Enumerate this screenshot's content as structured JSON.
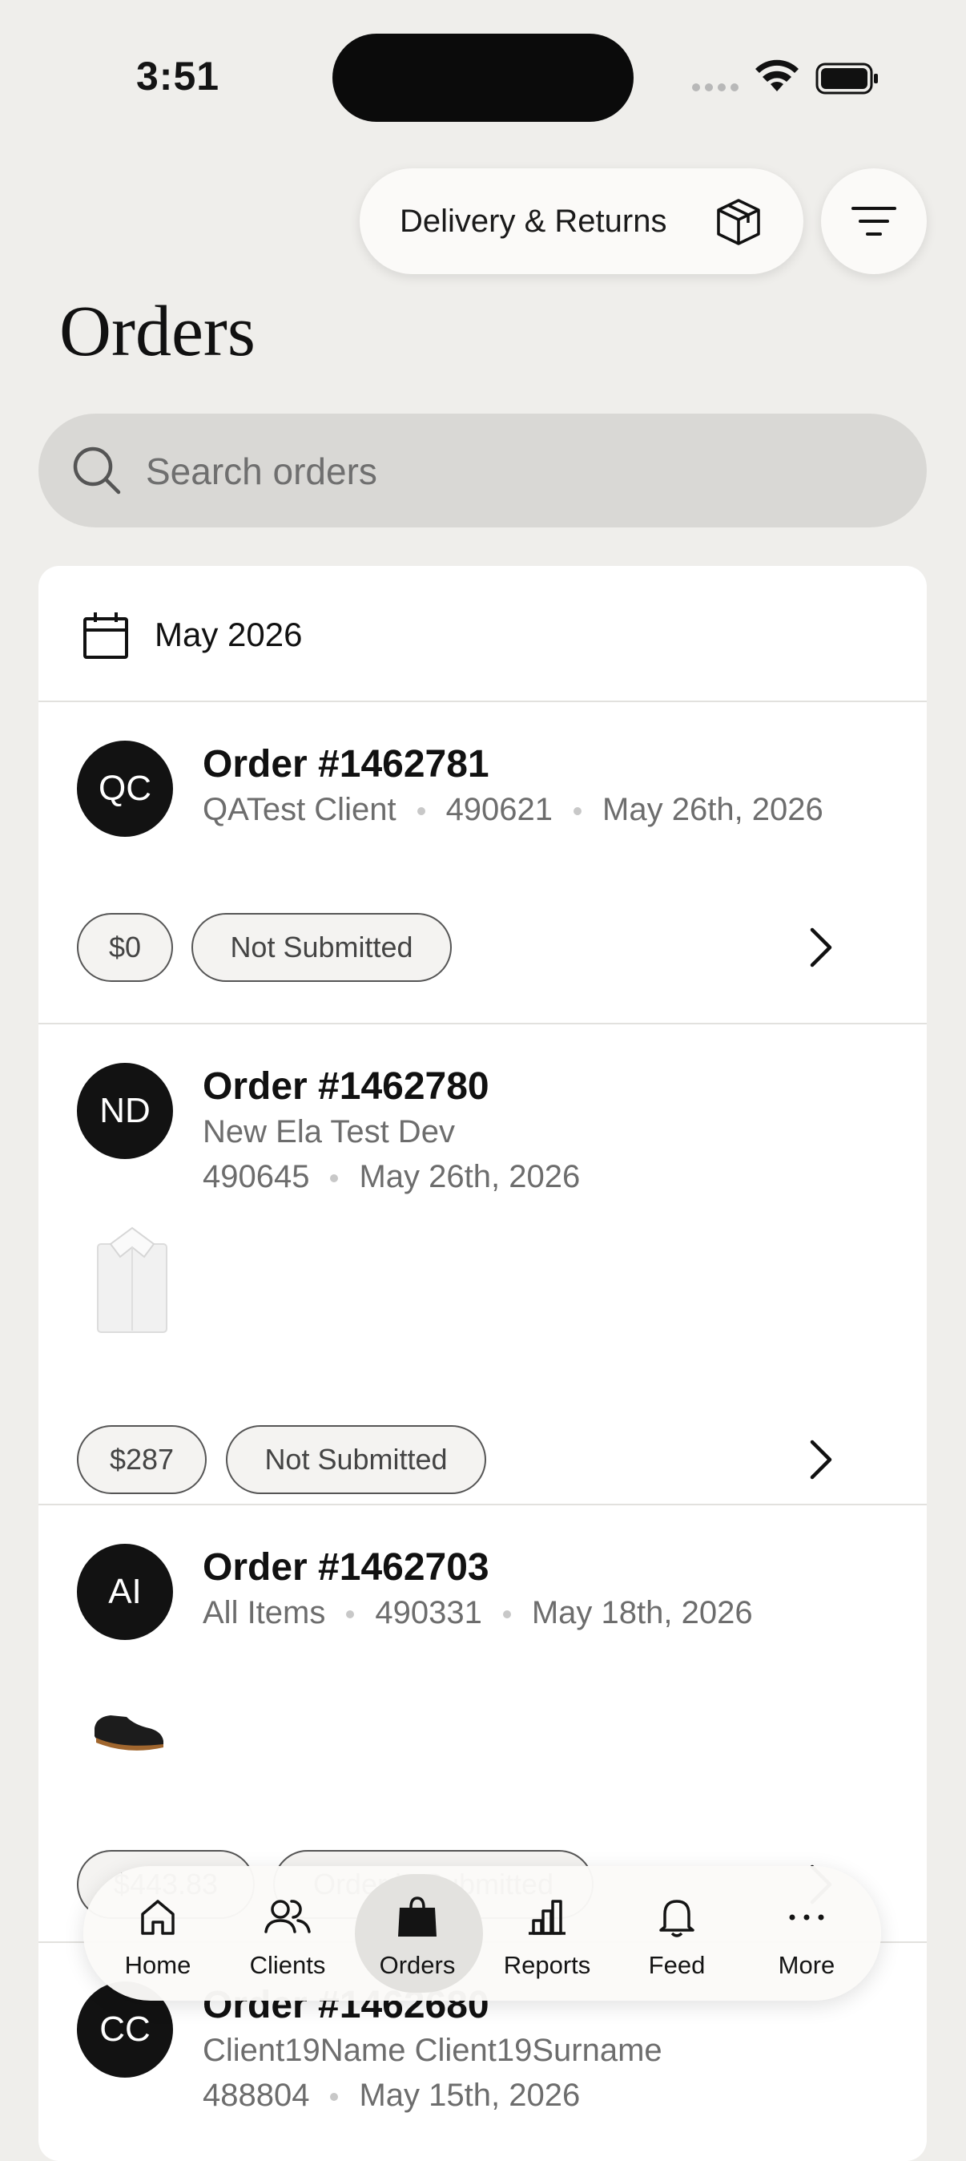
{
  "status_bar": {
    "time": "3:51"
  },
  "header": {
    "delivery_button_label": "Delivery & Returns",
    "title": "Orders"
  },
  "search": {
    "placeholder": "Search orders"
  },
  "month": "May 2026",
  "orders": [
    {
      "initials": "QC",
      "title": "Order #1462781",
      "client": "QATest Client",
      "account": "490621",
      "date": "May 26th, 2026",
      "amount": "$0",
      "status": "Not Submitted"
    },
    {
      "initials": "ND",
      "title": "Order #1462780",
      "client": "New Ela Test Dev",
      "account": "490645",
      "date": "May 26th, 2026",
      "amount": "$287",
      "status": "Not Submitted",
      "thumbnail": "white-shirt"
    },
    {
      "initials": "AI",
      "title": "Order #1462703",
      "client": "All Items",
      "account": "490331",
      "date": "May 18th, 2026",
      "amount": "$443.83",
      "status": "Order is Submitted",
      "thumbnail": "black-shoe"
    },
    {
      "initials": "CC",
      "title": "Order #1462680",
      "client": "Client19Name Client19Surname",
      "account": "488804",
      "date": "May 15th, 2026"
    }
  ],
  "tabbar": {
    "items": [
      {
        "label": "Home",
        "icon": "home-icon"
      },
      {
        "label": "Clients",
        "icon": "clients-icon"
      },
      {
        "label": "Orders",
        "icon": "shopping-bag-icon",
        "active": true
      },
      {
        "label": "Reports",
        "icon": "bar-chart-icon"
      },
      {
        "label": "Feed",
        "icon": "bell-icon"
      },
      {
        "label": "More",
        "icon": "more-dots-icon"
      }
    ]
  }
}
